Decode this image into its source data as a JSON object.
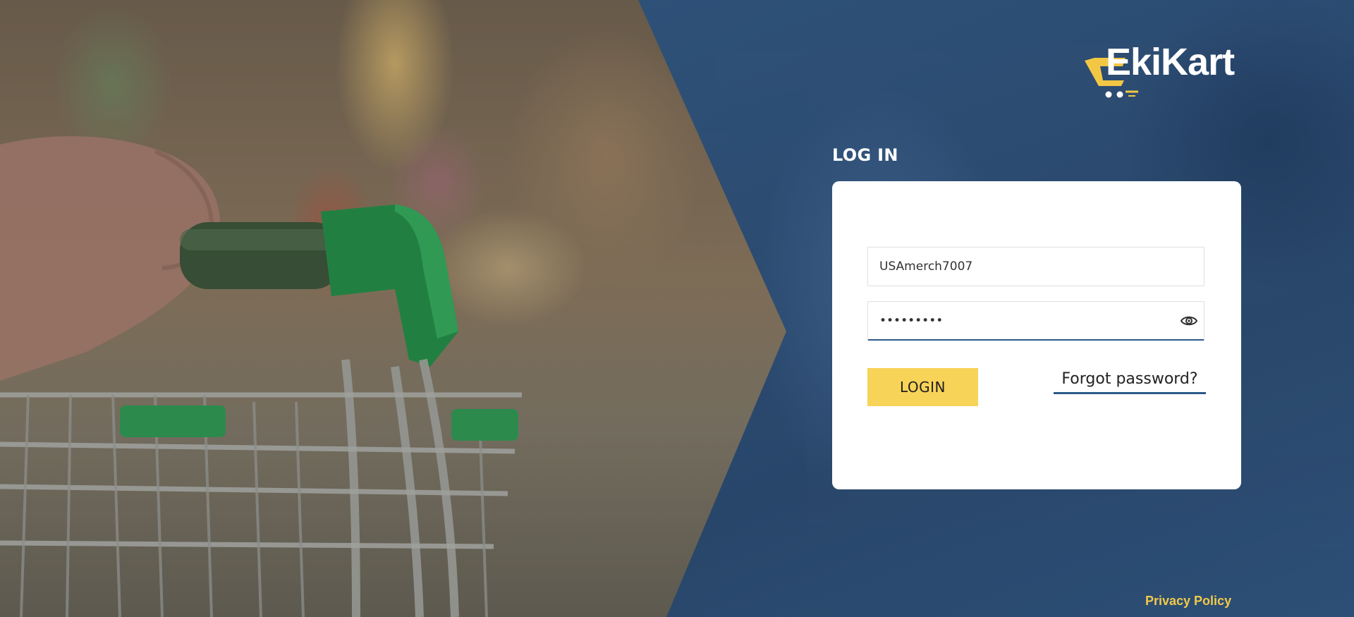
{
  "brand": {
    "name": "EkiKart",
    "accent_color": "#f7d358",
    "panel_color": "#2b4d75"
  },
  "login": {
    "heading": "LOG IN",
    "username_value": "USAmerch7007",
    "password_value": "•••••••••",
    "show_password_icon": "eye-icon",
    "submit_label": "LOGIN",
    "forgot_label": "Forgot password?"
  },
  "footer": {
    "privacy_label": "Privacy Policy"
  }
}
